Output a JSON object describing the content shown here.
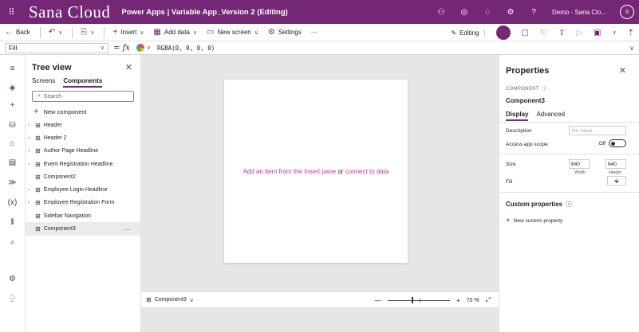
{
  "titlebar": {
    "brand": "Sana Cloud",
    "app_title": "Power Apps | Variable App_Version 2 (Editing)",
    "environment": "Demo - Sana Clo...",
    "avatar_initials": "S"
  },
  "commandbar": {
    "back": "Back",
    "insert": "Insert",
    "add_data": "Add data",
    "new_screen": "New screen",
    "settings": "Settings",
    "more": "···",
    "editing": "Editing"
  },
  "formulabar": {
    "property": "Fill",
    "eq": "=",
    "fx": "fx",
    "formula": "RGBA(0, 0, 0, 0)"
  },
  "tree": {
    "title": "Tree view",
    "tabs": [
      "Screens",
      "Components"
    ],
    "search_placeholder": "Search",
    "new_component": "New component",
    "items": [
      {
        "label": "Header",
        "expandable": true
      },
      {
        "label": "Header 2",
        "expandable": true
      },
      {
        "label": "Author Page Headline",
        "expandable": true
      },
      {
        "label": "Event Registration Headline",
        "expandable": true
      },
      {
        "label": "Component2",
        "expandable": false
      },
      {
        "label": "Employee Login Headline",
        "expandable": true
      },
      {
        "label": "Employee Registration Form",
        "expandable": true
      },
      {
        "label": "Sidebar Navigation",
        "expandable": false
      },
      {
        "label": "Component3",
        "expandable": false,
        "selected": true
      }
    ],
    "more": "···"
  },
  "canvas": {
    "msg_part1": "Add an item from the Insert pane",
    "msg_or": " or ",
    "msg_part2": "connect to data",
    "footer_component": "Component3",
    "zoom_minus": "—",
    "zoom_plus": "+",
    "zoom_value": "70 %"
  },
  "properties": {
    "title": "Properties",
    "type": "COMPONENT",
    "name": "Component3",
    "tabs": [
      "Display",
      "Advanced"
    ],
    "description_label": "Description",
    "description_placeholder": "No value",
    "access_label": "Access app scope",
    "access_value": "Off",
    "size_label": "Size",
    "width_value": "640",
    "height_value": "640",
    "width_label": "Width",
    "height_label": "Height",
    "fill_label": "Fill",
    "custom_title": "Custom properties",
    "new_custom": "New custom property"
  },
  "colors": {
    "accent": "#742774",
    "link": "#c3338c"
  }
}
